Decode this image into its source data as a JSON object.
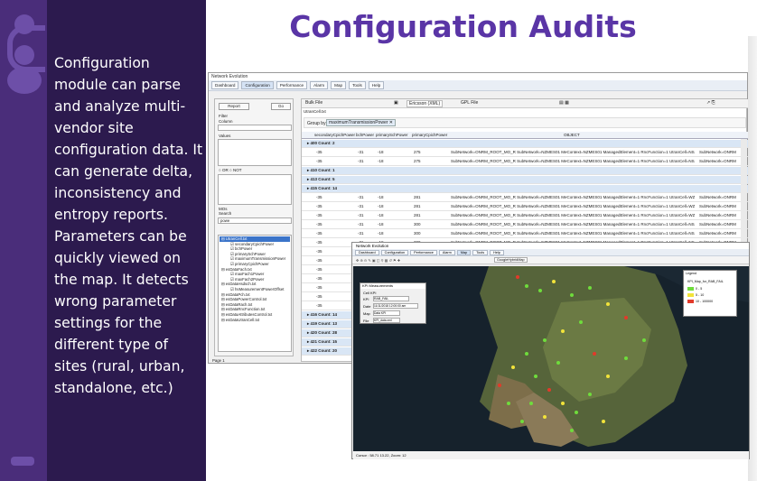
{
  "slide": {
    "title": "Configuration Audits",
    "description": "Configuration module can parse and analyze multi-vendor site configuration data. It can generate delta, inconsistency and entropy reports. Parameters can be quickly viewed on the map. It detects wrong parameter settings for the different type of sites (rural, urban, standalone, etc.)",
    "colors": {
      "accent": "#5a35a6",
      "panel": "#2c1a4e",
      "band": "#4a2d7a"
    }
  },
  "app": {
    "window_title": "Network Evolution",
    "tabs": [
      "Dashboard",
      "Configuration",
      "Performance",
      "Alarm",
      "Map",
      "Tools",
      "Help"
    ],
    "toolbar": {
      "bulk_file": "Bulk File",
      "vendor": "Ericsson (XML)",
      "gpl_file": "GPL File",
      "file_name": "UtranCell.txt"
    },
    "group_by_label": "Group by:",
    "group_by_chip": "maximumTransmissionPower",
    "columns": [
      "secondaryCpichPower",
      "bchPower",
      "primarySchPower",
      "primaryCpichPower",
      "OBJECT"
    ],
    "sidebar": {
      "report": "Report",
      "go": "Go",
      "filter": "Filter",
      "column": "Column",
      "values": "Values",
      "or": "OR",
      "not": "NOT",
      "mos": "MOs",
      "search": "Search",
      "search_value": "powe",
      "page": "Page 1",
      "tree": [
        "UtranCell.txt",
        "secondaryCpichPower",
        "bchPower",
        "primarySchPower",
        "maximumTransmissionPower",
        "primaryCpichPower",
        "esDataFach.txt",
        "maxFach1Power",
        "maxFach2Power",
        "esDataHsdsch.txt",
        "hsMeasurementPowerOffset",
        "esDataPch.txt",
        "esDataPowerControl.txt",
        "esDataRach.txt",
        "esDataRncFunction.txt",
        "esDataAttributesControl.txt",
        "esDataUtranCell.txt"
      ]
    },
    "rows": [
      {
        "kind": "group",
        "label": "400 Count: 2"
      },
      {
        "kind": "data",
        "v": [
          "-35",
          "-31",
          "-18",
          "275"
        ],
        "obj": "SubNetwork=ONRM_ROOT_MO_R SubNetwork=NZMES01 MeContext=NZMES01 ManagedElement=1 RncFunction=1 UtranCell=NS42456",
        "obj2": "SubNetwork=ONRM"
      },
      {
        "kind": "data",
        "v": [
          "-35",
          "-31",
          "-18",
          "275"
        ],
        "obj": "SubNetwork=ONRM_ROOT_MO_R SubNetwork=NZMES01 MeContext=NZMES01 ManagedElement=1 RncFunction=1 UtranCell=NS42458",
        "obj2": "SubNetwork=ONRM"
      },
      {
        "kind": "group",
        "label": "410 Count: 1"
      },
      {
        "kind": "group",
        "label": "413 Count: 5"
      },
      {
        "kind": "group",
        "label": "415 Count: 14"
      },
      {
        "kind": "data",
        "v": [
          "-35",
          "-31",
          "-18",
          "281"
        ],
        "obj": "SubNetwork=ONRM_ROOT_MO_R SubNetwork=NZMES01 MeContext=NZMES01 ManagedElement=1 RncFunction=1 UtranCell=WZ04116",
        "obj2": "SubNetwork=ONRM"
      },
      {
        "kind": "data",
        "v": [
          "-35",
          "-31",
          "-18",
          "281"
        ],
        "obj": "SubNetwork=ONRM_ROOT_MO_R SubNetwork=NZMES01 MeContext=NZMES01 ManagedElement=1 RncFunction=1 UtranCell=WZ04117",
        "obj2": "SubNetwork=ONRM"
      },
      {
        "kind": "data",
        "v": [
          "-35",
          "-31",
          "-18",
          "281"
        ],
        "obj": "SubNetwork=ONRM_ROOT_MO_R SubNetwork=NZMES01 MeContext=NZMES01 ManagedElement=1 RncFunction=1 UtranCell=WZ04118",
        "obj2": "SubNetwork=ONRM"
      },
      {
        "kind": "data",
        "v": [
          "-35",
          "-31",
          "-18",
          "300"
        ],
        "obj": "SubNetwork=ONRM_ROOT_MO_R SubNetwork=NZMES01 MeContext=NZMES01 ManagedElement=1 RncFunction=1 UtranCell=NS40546",
        "obj2": "SubNetwork=ONRM"
      },
      {
        "kind": "data",
        "v": [
          "-35",
          "-31",
          "-18",
          "300"
        ],
        "obj": "SubNetwork=ONRM_ROOT_MO_R SubNetwork=NZMES01 MeContext=NZMES01 ManagedElement=1 RncFunction=1 UtranCell=NS40547",
        "obj2": "SubNetwork=ONRM"
      },
      {
        "kind": "data",
        "v": [
          "-35",
          "-31",
          "-18",
          "300"
        ],
        "obj": "SubNetwork=ONRM_ROOT_MO_R SubNetwork=NZMES01 MeContext=NZMES01 ManagedElement=1 RncFunction=1 UtranCell=NS40548",
        "obj2": "SubNetwork=ONRM"
      },
      {
        "kind": "data",
        "v": [
          "-35",
          "",
          "",
          ""
        ],
        "obj": "",
        "obj2": ""
      },
      {
        "kind": "data",
        "v": [
          "-35",
          "",
          "",
          ""
        ],
        "obj": "",
        "obj2": ""
      },
      {
        "kind": "data",
        "v": [
          "-35",
          "",
          "",
          ""
        ],
        "obj": "",
        "obj2": ""
      },
      {
        "kind": "data",
        "v": [
          "-35",
          "",
          "",
          ""
        ],
        "obj": "",
        "obj2": ""
      },
      {
        "kind": "data",
        "v": [
          "-35",
          "",
          "",
          ""
        ],
        "obj": "",
        "obj2": ""
      },
      {
        "kind": "data",
        "v": [
          "-35",
          "",
          "",
          ""
        ],
        "obj": "",
        "obj2": ""
      },
      {
        "kind": "data",
        "v": [
          "-35",
          "",
          "",
          ""
        ],
        "obj": "",
        "obj2": ""
      },
      {
        "kind": "group",
        "label": "416 Count: 14"
      },
      {
        "kind": "group",
        "label": "419 Count: 13"
      },
      {
        "kind": "group",
        "label": "420 Count: 28"
      },
      {
        "kind": "group",
        "label": "421 Count: 15"
      },
      {
        "kind": "group",
        "label": "422 Count: 20"
      }
    ]
  },
  "map_window": {
    "title": "Network Evolution",
    "tabs": [
      "Dashboard",
      "Configuration",
      "Performance",
      "Alarm",
      "Map",
      "Tools",
      "Help"
    ],
    "map_layer": "GoogleHybridMap",
    "status": "Cursor : 58.71 13.22, Zoom: 12",
    "kpi_dialog": {
      "title": "KPI Measurements",
      "cell_kpi": "Cell KPI",
      "kpi_label": "KPI",
      "kpi_value": "RAB_FAIL",
      "date_label": "Date",
      "date_value": "11/11/2018 12:00:00 am",
      "map_label": "Map",
      "map_value": "Data KPI",
      "file_label": "File",
      "file_value": "KPI_data.xml"
    },
    "legend": {
      "title": "Legend",
      "layer": "KPI_Map_for_RAB_FAIL",
      "ranges": [
        {
          "color": "#6fdc3c",
          "label": "0 - 5"
        },
        {
          "color": "#f2e33a",
          "label": "5 - 10"
        },
        {
          "color": "#e23a2a",
          "label": "10 - 100000"
        }
      ]
    }
  }
}
